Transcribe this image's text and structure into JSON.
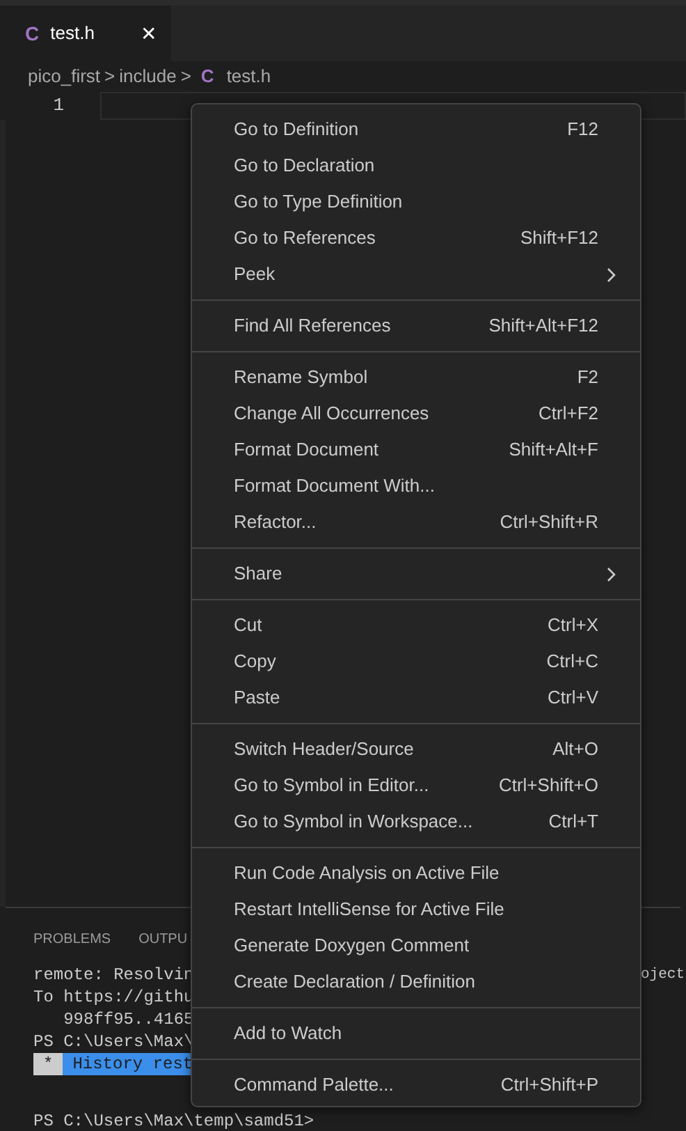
{
  "tab": {
    "icon": "C",
    "title": "test.h",
    "close": "✕"
  },
  "breadcrumb": {
    "parts": [
      "pico_first",
      "include"
    ],
    "separator": ">",
    "file_icon": "C",
    "file": "test.h"
  },
  "editor": {
    "line_number": "1"
  },
  "panel": {
    "tabs": [
      {
        "label": "PROBLEMS",
        "selected": false
      },
      {
        "label": "OUTPU",
        "selected": false
      }
    ]
  },
  "terminal": {
    "lines": [
      {
        "kind": "text",
        "text": "remote: Resolvin",
        "right": "oject"
      },
      {
        "kind": "text",
        "text": "To https://githu"
      },
      {
        "kind": "text",
        "text": "   998ff95..4165"
      },
      {
        "kind": "text",
        "text": "PS C:\\Users\\Max\\"
      },
      {
        "kind": "highlight",
        "marker": "*",
        "text": "History rest"
      },
      {
        "kind": "blank"
      },
      {
        "kind": "text",
        "text": "PS C:\\Users\\Max\\temp\\samd51>"
      }
    ]
  },
  "context_menu": {
    "groups": [
      [
        {
          "label": "Go to Definition",
          "shortcut": "F12"
        },
        {
          "label": "Go to Declaration"
        },
        {
          "label": "Go to Type Definition"
        },
        {
          "label": "Go to References",
          "shortcut": "Shift+F12"
        },
        {
          "label": "Peek",
          "kind": "submenu"
        }
      ],
      [
        {
          "label": "Find All References",
          "shortcut": "Shift+Alt+F12"
        }
      ],
      [
        {
          "label": "Rename Symbol",
          "shortcut": "F2"
        },
        {
          "label": "Change All Occurrences",
          "shortcut": "Ctrl+F2"
        },
        {
          "label": "Format Document",
          "shortcut": "Shift+Alt+F"
        },
        {
          "label": "Format Document With..."
        },
        {
          "label": "Refactor...",
          "shortcut": "Ctrl+Shift+R"
        }
      ],
      [
        {
          "label": "Share",
          "kind": "submenu"
        }
      ],
      [
        {
          "label": "Cut",
          "shortcut": "Ctrl+X"
        },
        {
          "label": "Copy",
          "shortcut": "Ctrl+C"
        },
        {
          "label": "Paste",
          "shortcut": "Ctrl+V"
        }
      ],
      [
        {
          "label": "Switch Header/Source",
          "shortcut": "Alt+O"
        },
        {
          "label": "Go to Symbol in Editor...",
          "shortcut": "Ctrl+Shift+O"
        },
        {
          "label": "Go to Symbol in Workspace...",
          "shortcut": "Ctrl+T"
        }
      ],
      [
        {
          "label": "Run Code Analysis on Active File"
        },
        {
          "label": "Restart IntelliSense for Active File"
        },
        {
          "label": "Generate Doxygen Comment"
        },
        {
          "label": "Create Declaration / Definition"
        }
      ],
      [
        {
          "label": "Add to Watch"
        }
      ],
      [
        {
          "label": "Command Palette...",
          "shortcut": "Ctrl+Shift+P"
        }
      ]
    ]
  }
}
